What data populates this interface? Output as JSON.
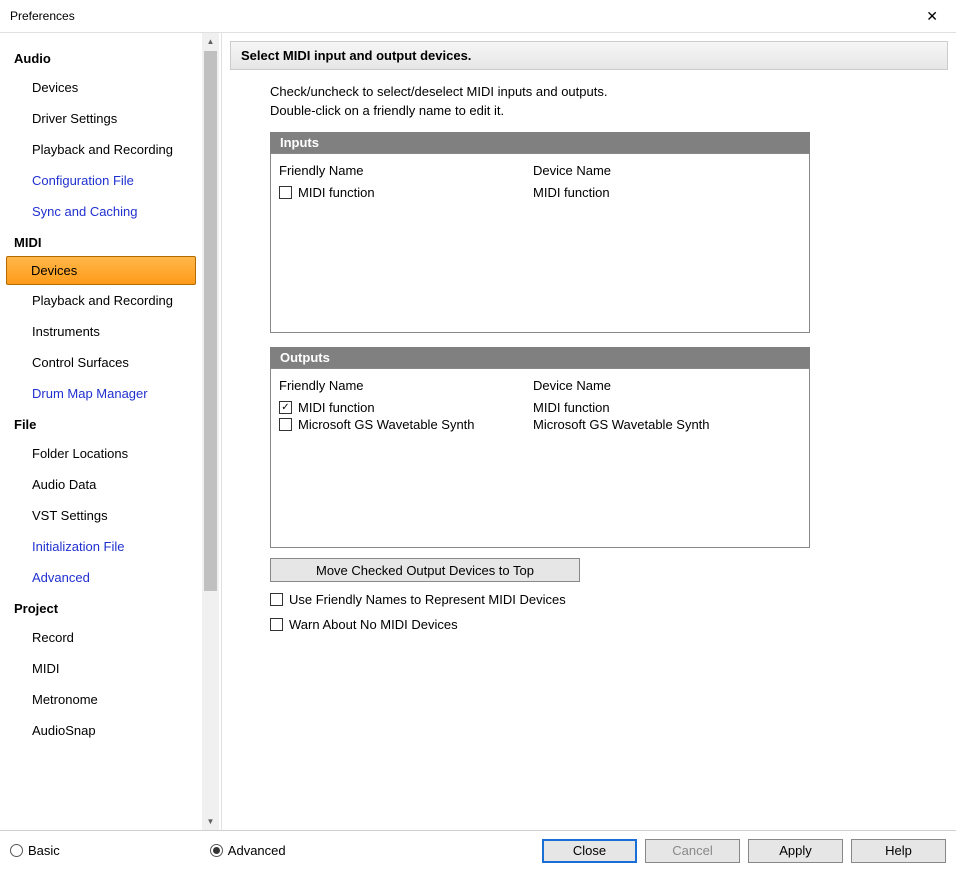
{
  "window": {
    "title": "Preferences"
  },
  "sidebar": {
    "categories": [
      {
        "name": "Audio",
        "items": [
          {
            "label": "Devices",
            "link": false
          },
          {
            "label": "Driver Settings",
            "link": false
          },
          {
            "label": "Playback and Recording",
            "link": false
          },
          {
            "label": "Configuration File",
            "link": true
          },
          {
            "label": "Sync and Caching",
            "link": true
          }
        ]
      },
      {
        "name": "MIDI",
        "items": [
          {
            "label": "Devices",
            "link": false,
            "selected": true
          },
          {
            "label": "Playback and Recording",
            "link": false
          },
          {
            "label": "Instruments",
            "link": false
          },
          {
            "label": "Control Surfaces",
            "link": false
          },
          {
            "label": "Drum Map Manager",
            "link": true
          }
        ]
      },
      {
        "name": "File",
        "items": [
          {
            "label": "Folder Locations",
            "link": false
          },
          {
            "label": "Audio Data",
            "link": false
          },
          {
            "label": "VST Settings",
            "link": false
          },
          {
            "label": "Initialization File",
            "link": true
          },
          {
            "label": "Advanced",
            "link": true
          }
        ]
      },
      {
        "name": "Project",
        "items": [
          {
            "label": "Record",
            "link": false
          },
          {
            "label": "MIDI",
            "link": false
          },
          {
            "label": "Metronome",
            "link": false
          },
          {
            "label": "AudioSnap",
            "link": false
          }
        ]
      }
    ]
  },
  "content": {
    "header": "Select MIDI input and output devices.",
    "desc1": "Check/uncheck to select/deselect MIDI inputs and outputs.",
    "desc2": "Double-click on a friendly name to edit it.",
    "inputs": {
      "title": "Inputs",
      "col1": "Friendly Name",
      "col2": "Device Name",
      "rows": [
        {
          "friendly": "MIDI function",
          "device": "MIDI function",
          "checked": false
        }
      ]
    },
    "outputs": {
      "title": "Outputs",
      "col1": "Friendly Name",
      "col2": "Device Name",
      "rows": [
        {
          "friendly": "MIDI function",
          "device": "MIDI function",
          "checked": true
        },
        {
          "friendly": "Microsoft GS Wavetable Synth",
          "device": "Microsoft GS Wavetable Synth",
          "checked": false
        }
      ]
    },
    "move_button": "Move Checked Output Devices to Top",
    "opt_friendly": "Use Friendly Names to Represent MIDI Devices",
    "opt_warn": "Warn About No MIDI Devices"
  },
  "footer": {
    "basic": "Basic",
    "advanced": "Advanced",
    "close": "Close",
    "cancel": "Cancel",
    "apply": "Apply",
    "help": "Help"
  }
}
